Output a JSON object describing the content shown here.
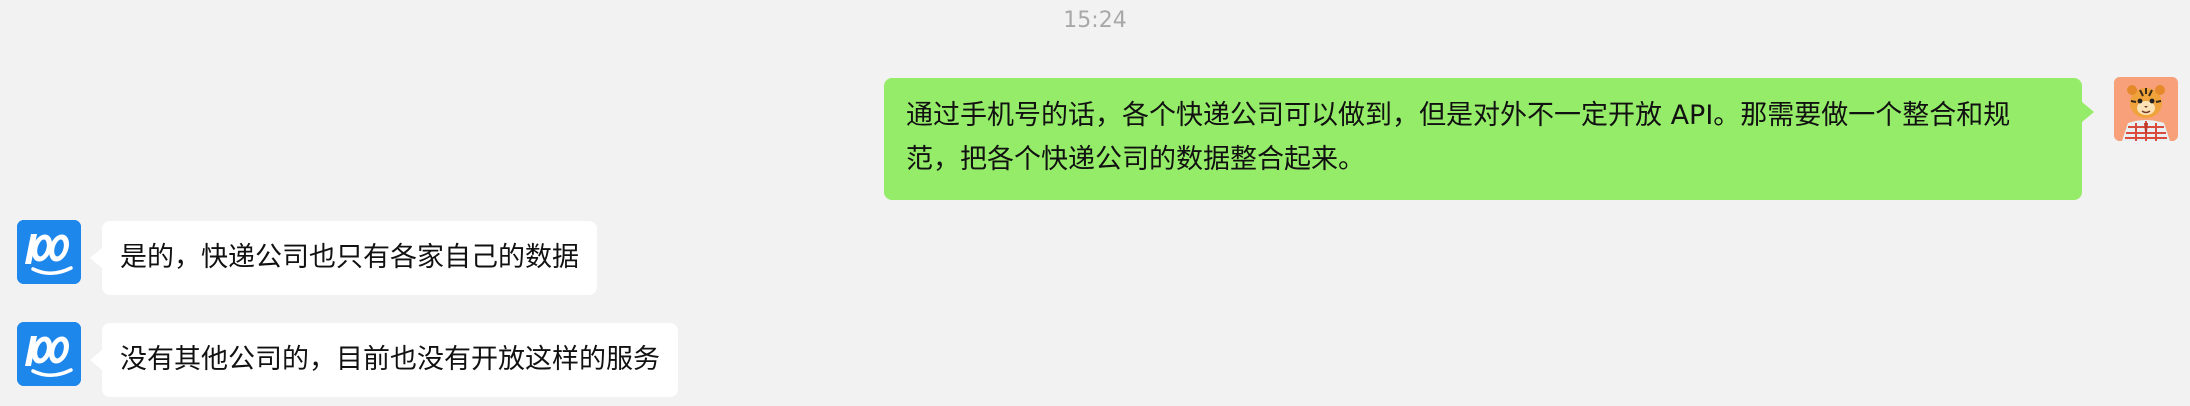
{
  "chat": {
    "timestamp": "15:24",
    "messages": [
      {
        "side": "right",
        "text": "通过手机号的话，各个快递公司可以做到，但是对外不一定开放 API。那需要做一个整合和规范，把各个快递公司的数据整合起来。",
        "avatar_icon": "tiger-avatar-icon"
      },
      {
        "side": "left",
        "text": "是的，快递公司也只有各家自己的数据",
        "avatar_icon": "kuaidi100-logo-icon"
      },
      {
        "side": "left",
        "text": "没有其他公司的，目前也没有开放这样的服务",
        "avatar_icon": "kuaidi100-logo-icon"
      }
    ],
    "colors": {
      "background": "#f2f2f2",
      "outgoing_bubble": "#95ec69",
      "incoming_bubble": "#ffffff",
      "bot_avatar": "#1d87ec",
      "timestamp_text": "#a8a8a8"
    }
  }
}
